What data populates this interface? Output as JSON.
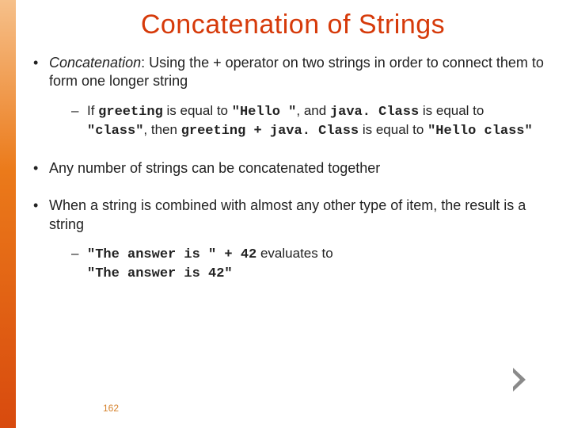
{
  "title": "Concatenation of Strings",
  "pageNumber": "162",
  "bullet1": {
    "lead": "Concatenation",
    "rest": ":  Using the + operator on two strings in order to connect them to form one longer string",
    "sub": {
      "t1": "If ",
      "c1": "greeting",
      "t2": " is equal to ",
      "c2": "\"Hello \"",
      "t3": ", and ",
      "c3": "java. Class",
      "t4": " is equal to ",
      "c4": "\"class\"",
      "t5": ", then ",
      "c5": "greeting + java. Class",
      "t6": " is equal to ",
      "c6": "\"Hello class\""
    }
  },
  "bullet2": "Any number of strings can be concatenated together",
  "bullet3": {
    "text": "When a string is combined with almost any other type of item, the result is a string",
    "sub": {
      "c1": "\"The answer is \" + 42",
      "t1": "  evaluates to",
      "c2": "\"The answer is 42\""
    }
  }
}
